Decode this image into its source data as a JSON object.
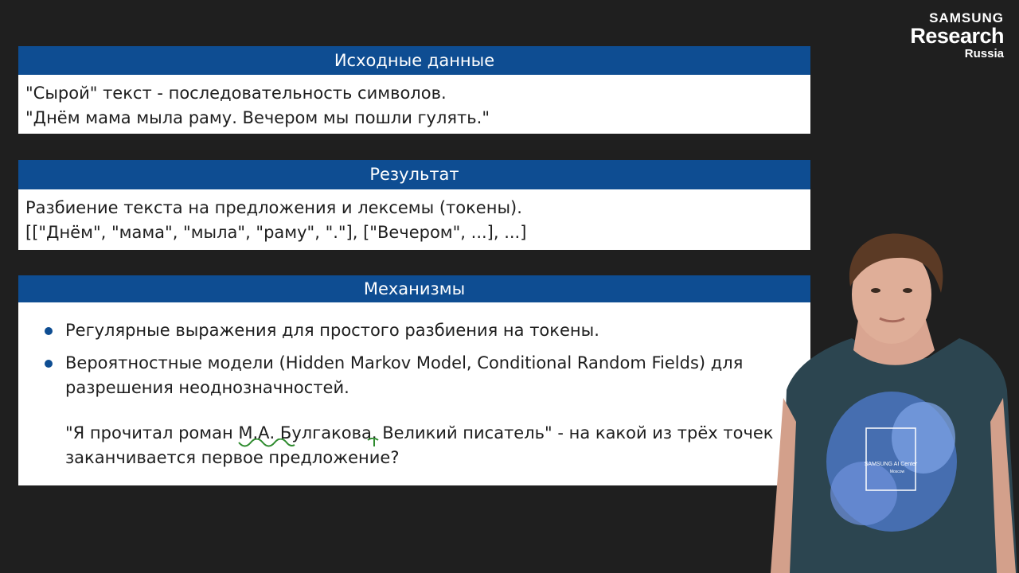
{
  "logo": {
    "line1": "SAMSUNG",
    "line2": "Research",
    "line3": "Russia"
  },
  "block1": {
    "title": "Исходные данные",
    "lines": [
      "\"Сырой\" текст - последовательность символов.",
      "\"Днём мама мыла раму. Вечером мы пошли гулять.\""
    ]
  },
  "block2": {
    "title": "Результат",
    "lines": [
      "Разбиение текста на предложения и лексемы (токены).",
      "[[\"Днём\", \"мама\", \"мыла\", \"раму\", \".\"], [\"Вечером\", ...], ...]"
    ]
  },
  "block3": {
    "title": "Механизмы",
    "bullets": [
      {
        "lines": [
          "Регулярные выражения для простого разбиения на токены."
        ]
      },
      {
        "lines": [
          "Вероятностные модели (Hidden Markov Model, Conditional Random Fields) для",
          "разрешения неоднозначностей."
        ]
      }
    ],
    "example": {
      "line1_before": "\"Я прочитал роман ",
      "line1_highlight": "М.А.",
      "line1_mid": " Булгакова",
      "line1_dot": ".",
      "line1_after": " Великий писатель\" - на какой из трёх точек",
      "line2": "заканчивается первое предложение?"
    }
  },
  "colors": {
    "header_bg": "#0e4d92",
    "annotation": "#2e8b2e",
    "background": "#1f1f1f"
  },
  "tshirt_text": {
    "line1": "SAMSUNG AI Center",
    "line2": "Moscow"
  }
}
